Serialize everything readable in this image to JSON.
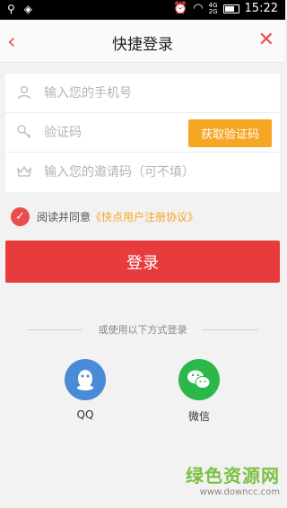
{
  "status_bar": {
    "time": "15:22",
    "signal1": "4G",
    "signal2": "2G"
  },
  "header": {
    "title": "快捷登录"
  },
  "form": {
    "phone_placeholder": "输入您的手机号",
    "code_placeholder": "验证码",
    "get_code_label": "获取验证码",
    "invite_placeholder": "输入您的邀请码（可不填）"
  },
  "agreement": {
    "text": "阅读并同意",
    "link": "《快点用户注册协议》",
    "checked": true
  },
  "login_label": "登录",
  "other_login": {
    "label": "或使用以下方式登录",
    "qq": "QQ",
    "wechat": "微信"
  },
  "watermark": {
    "brand": "绿色资源网",
    "url": "www.downcc.com"
  },
  "colors": {
    "accent": "#e83c3c",
    "orange": "#f5a623",
    "qq": "#4a8bd8",
    "wechat": "#2bb74a"
  }
}
